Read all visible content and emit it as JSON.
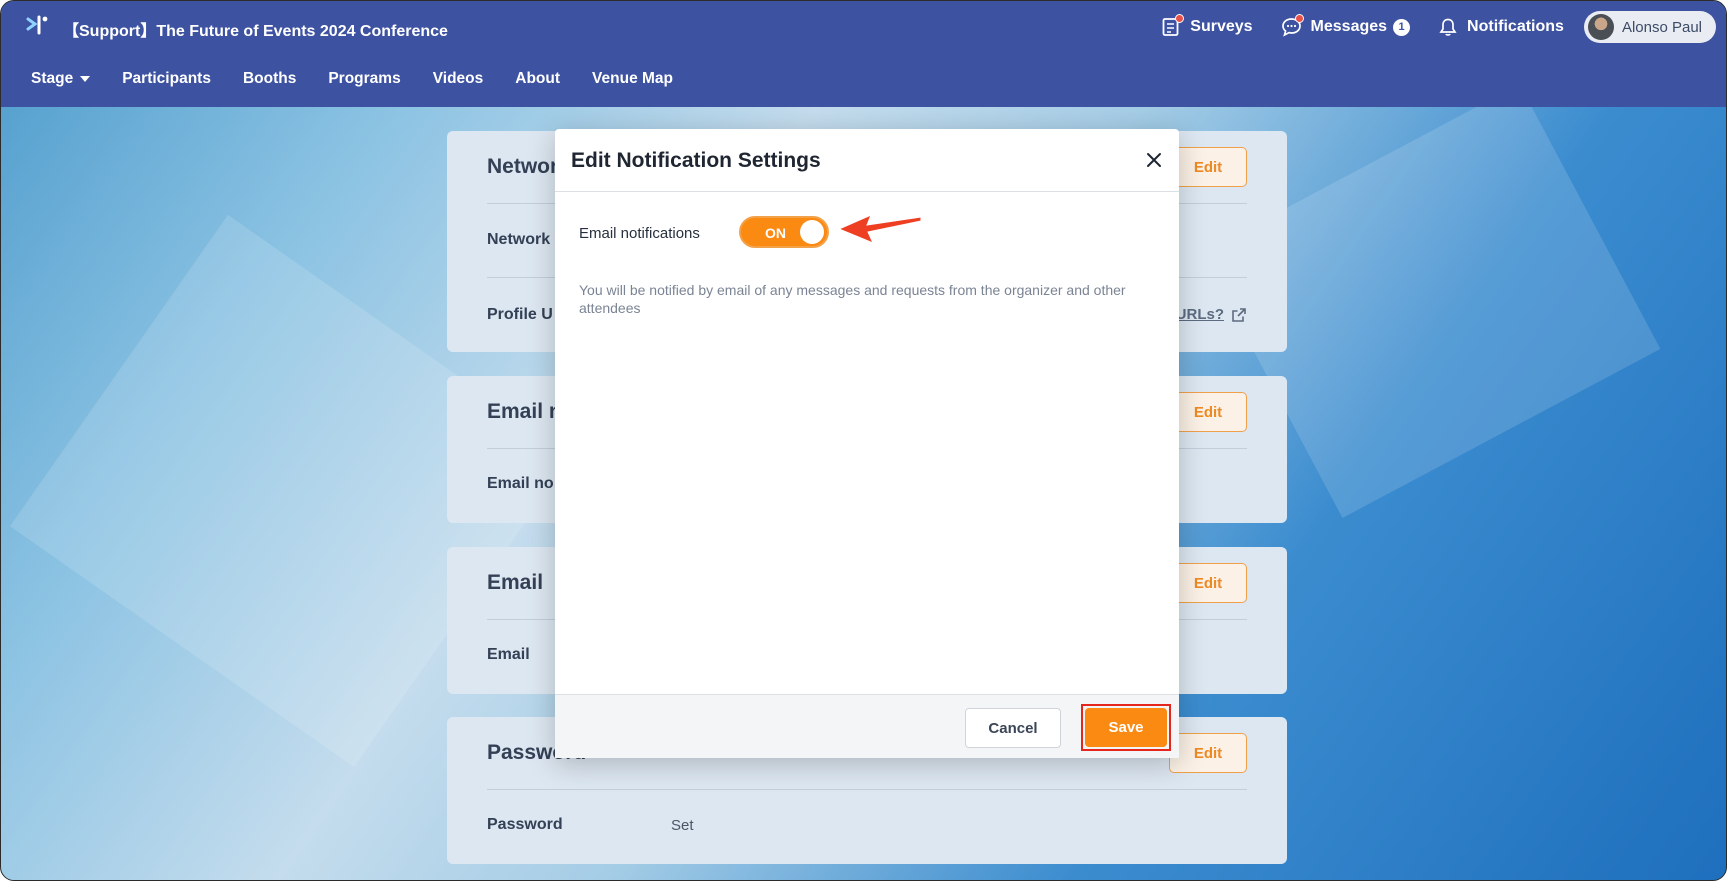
{
  "header": {
    "event_title": "【Support】The Future of Events 2024 Conference",
    "surveys_label": "Surveys",
    "messages_label": "Messages",
    "messages_count": "1",
    "notifications_label": "Notifications",
    "user_name": "Alonso Paul"
  },
  "nav": {
    "items": [
      "Stage",
      "Participants",
      "Booths",
      "Programs",
      "Videos",
      "About",
      "Venue Map"
    ]
  },
  "cards": {
    "networking": {
      "title": "Networ",
      "row1_label": "Network",
      "row2_label": "Profile U",
      "help_link": "URLs?",
      "edit_label": "Edit"
    },
    "email_notifications": {
      "title": "Email n",
      "row1_label": "Email no",
      "edit_label": "Edit"
    },
    "email": {
      "title": "Email",
      "row1_label": "Email",
      "edit_label": "Edit"
    },
    "password": {
      "title": "Password",
      "row1_label": "Password",
      "row1_value": "Set",
      "edit_label": "Edit"
    }
  },
  "modal": {
    "title": "Edit Notification Settings",
    "setting_label": "Email notifications",
    "toggle_state": "ON",
    "description": "You will be notified by email of any messages and requests from the organizer and other attendees",
    "cancel_label": "Cancel",
    "save_label": "Save"
  },
  "colors": {
    "header_bg": "#3d52a0",
    "accent_orange": "#fb8a12",
    "highlight_red": "#e4261d"
  }
}
